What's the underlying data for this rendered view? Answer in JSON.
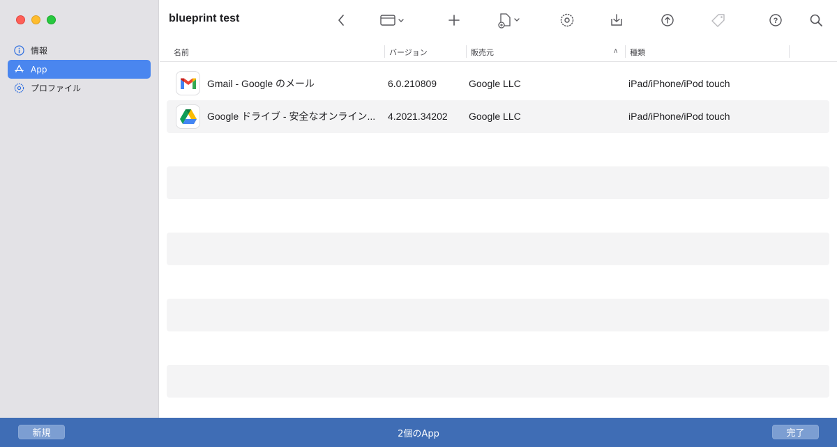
{
  "window": {
    "title": "blueprint test"
  },
  "sidebar": {
    "items": [
      {
        "label": "情報",
        "icon": "info-icon",
        "active": false
      },
      {
        "label": "App",
        "icon": "app-store-icon",
        "active": true
      },
      {
        "label": "プロファイル",
        "icon": "gear-icon",
        "active": false
      }
    ]
  },
  "toolbar": {
    "icons": [
      "chevron-left-icon",
      "window-icon",
      "plus-icon",
      "add-file-icon",
      "gear-icon",
      "download-icon",
      "upload-icon",
      "tag-icon",
      "help-icon",
      "search-icon"
    ]
  },
  "table": {
    "columns": [
      "名前",
      "バージョン",
      "販売元",
      "種類"
    ],
    "sort_column": "販売元",
    "rows": [
      {
        "name": "Gmail - Google のメール",
        "version": "6.0.210809",
        "vendor": "Google LLC",
        "kind": "iPad/iPhone/iPod touch",
        "icon": "gmail-icon"
      },
      {
        "name": "Google ドライブ - 安全なオンライン...",
        "version": "4.2021.34202",
        "vendor": "Google LLC",
        "kind": "iPad/iPhone/iPod touch",
        "icon": "google-drive-icon"
      }
    ]
  },
  "bottom": {
    "new_label": "新規",
    "status": "2個のApp",
    "done_label": "完了"
  },
  "colors": {
    "accent": "#4a86ef",
    "bottom_bar": "#3f6db5"
  }
}
